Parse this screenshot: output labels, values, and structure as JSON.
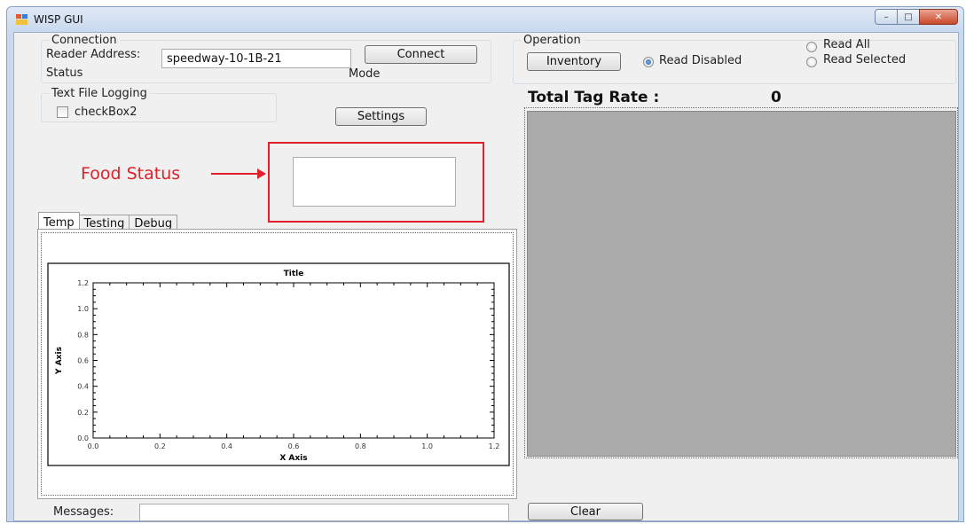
{
  "window": {
    "title": "WISP GUI"
  },
  "connection": {
    "group_label": "Connection",
    "reader_address_label": "Reader Address:",
    "reader_address_value": "speedway-10-1B-21",
    "connect_label": "Connect",
    "status_label": "Status",
    "mode_label": "Mode"
  },
  "logging": {
    "group_label": "Text File Logging",
    "checkbox_label": "checkBox2",
    "settings_label": "Settings"
  },
  "annotation": {
    "food_status_label": "Food Status"
  },
  "operation": {
    "group_label": "Operation",
    "inventory_label": "Inventory",
    "read_disabled_label": "Read Disabled",
    "read_all_label": "Read All",
    "read_selected_label": "Read Selected",
    "selected": "Read Disabled"
  },
  "tag_rate": {
    "label": "Total Tag Rate :",
    "value": "0"
  },
  "tabs": [
    {
      "label": "Temp",
      "active": true
    },
    {
      "label": "Testing",
      "active": false
    },
    {
      "label": "Debug",
      "active": false
    }
  ],
  "chart_data": {
    "type": "line",
    "title": "Title",
    "xlabel": "X Axis",
    "ylabel": "Y Axis",
    "xlim": [
      0,
      1.2
    ],
    "ylim": [
      0,
      1.2
    ],
    "x_ticks": [
      "0.0",
      "0.2",
      "0.4",
      "0.6",
      "0.8",
      "1.0",
      "1.2"
    ],
    "y_ticks": [
      "0.0",
      "0.2",
      "0.4",
      "0.6",
      "0.8",
      "1.0",
      "1.2"
    ],
    "series": [],
    "grid": false
  },
  "messages": {
    "label": "Messages:",
    "value": ""
  },
  "clear_label": "Clear",
  "colors": {
    "annotation": "#e0202a",
    "tag_panel": "#aaaaaa"
  }
}
